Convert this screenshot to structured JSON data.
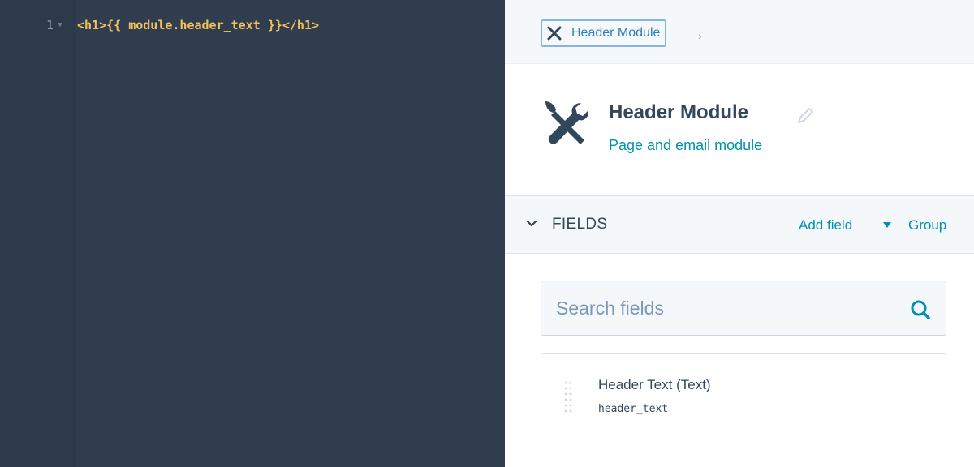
{
  "editor": {
    "lines": [
      {
        "number": "1",
        "code": "<h1>{{ module.header_text }}</h1>"
      }
    ]
  },
  "breadcrumb": {
    "icon": "close-x-icon",
    "label": "Header Module",
    "chevron": "›"
  },
  "module": {
    "icon": "tools-icon",
    "title": "Header Module",
    "subtitle": "Page and email module",
    "edit_icon": "pencil-icon"
  },
  "fields_section": {
    "title": "FIELDS",
    "add_field_label": "Add field",
    "group_label": "Group"
  },
  "search": {
    "placeholder": "Search fields",
    "value": ""
  },
  "fields": [
    {
      "name": "Header Text (Text)",
      "key": "header_text"
    }
  ],
  "colors": {
    "editor_bg": "#2f3d4e",
    "code_color": "#f4c05c",
    "link": "#0091ae",
    "text": "#33475b"
  }
}
